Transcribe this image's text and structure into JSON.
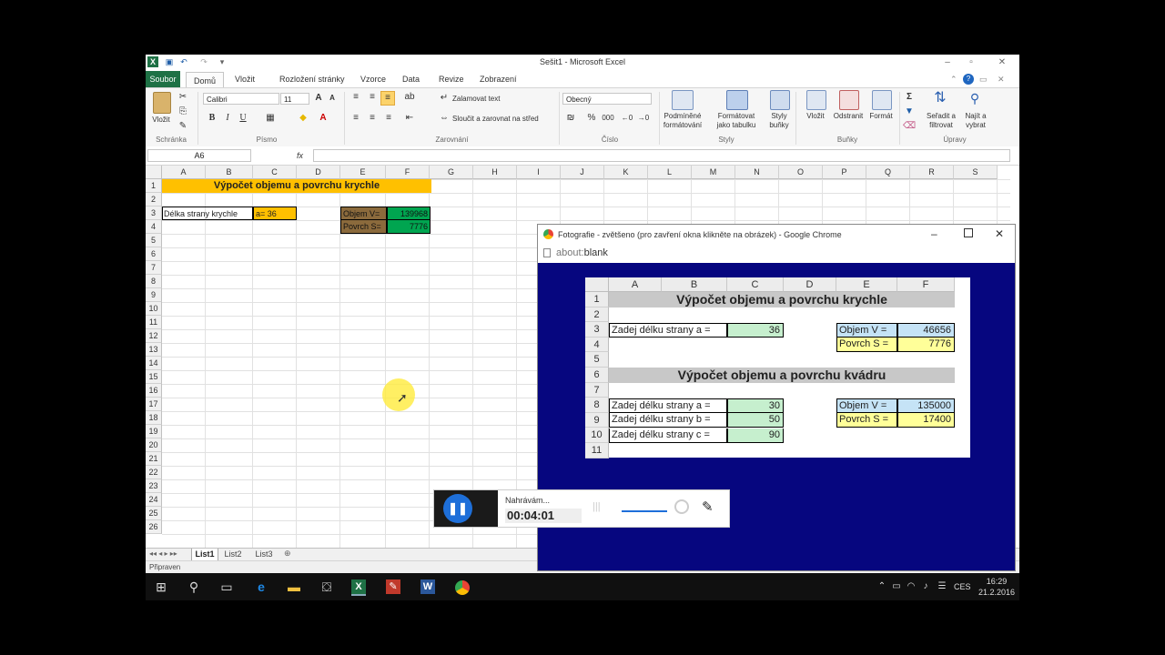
{
  "excel": {
    "window_title": "Sešit1 - Microsoft Excel",
    "tabs": [
      "Soubor",
      "Domů",
      "Vložit",
      "Rozložení stránky",
      "Vzorce",
      "Data",
      "Revize",
      "Zobrazení"
    ],
    "clipboard": {
      "paste": "Vložit",
      "group": "Schránka"
    },
    "font": {
      "name": "Calibri",
      "size": "11",
      "group": "Písmo"
    },
    "alignment": {
      "wrap": "Zalamovat text",
      "merge": "Sloučit a zarovnat na střed",
      "group": "Zarovnání"
    },
    "number": {
      "format": "Obecný",
      "group": "Číslo",
      "percent": "%",
      "thousands": "000"
    },
    "styles": {
      "cond1": "Podmíněné",
      "cond2": "formátování",
      "table1": "Formátovat",
      "table2": "jako tabulku",
      "cell1": "Styly",
      "cell2": "buňky",
      "group": "Styly"
    },
    "cells": {
      "insert": "Vložit",
      "delete": "Odstranit",
      "format": "Formát",
      "group": "Buňky"
    },
    "editing": {
      "sort1": "Seřadit a",
      "sort2": "filtrovat",
      "find1": "Najít a",
      "find2": "vybrat",
      "group": "Úpravy",
      "sigma": "Σ"
    },
    "name_box": "A6",
    "fx": "fx",
    "columns": [
      "A",
      "B",
      "C",
      "D",
      "E",
      "F",
      "G",
      "H",
      "I",
      "J",
      "K",
      "L",
      "M",
      "N",
      "O",
      "P",
      "Q",
      "R",
      "S"
    ],
    "rows": [
      "1",
      "2",
      "3",
      "4",
      "5",
      "6",
      "7",
      "8",
      "9",
      "10",
      "11",
      "12",
      "13",
      "14",
      "15",
      "16",
      "17",
      "18",
      "19",
      "20",
      "21",
      "22",
      "23",
      "24",
      "25",
      "26"
    ],
    "sheet": {
      "title": "Výpočet objemu a povrchu krychle",
      "side_label": "Délka strany krychle",
      "side_value": "a= 36",
      "volume_label": "Objem V=",
      "volume_value": "139968",
      "surface_label": "Povrch S=",
      "surface_value": "7776"
    },
    "sheet_tabs": [
      "List1",
      "List2",
      "List3"
    ],
    "status": "Připraven"
  },
  "chrome": {
    "title": "Fotografie - zvětšeno (pro zavření okna klikněte na obrázek) - Google Chrome",
    "url_prefix": "about:",
    "url_rest": "blank",
    "image": {
      "columns": [
        "A",
        "B",
        "C",
        "D",
        "E",
        "F"
      ],
      "rows": [
        "1",
        "2",
        "3",
        "4",
        "5",
        "6",
        "7",
        "8",
        "9",
        "10",
        "11"
      ],
      "cube_title": "Výpočet objemu a povrchu krychle",
      "cube_side_label": "Zadej délku strany a =",
      "cube_side_value": "36",
      "cube_volume_label": "Objem V =",
      "cube_volume_value": "46656",
      "cube_surface_label": "Povrch S =",
      "cube_surface_value": "7776",
      "box_title": "Výpočet objemu a povrchu kvádru",
      "box_a_label": "Zadej délku strany a =",
      "box_a_value": "30",
      "box_b_label": "Zadej délku strany b =",
      "box_b_value": "50",
      "box_c_label": "Zadej délku strany c =",
      "box_c_value": "90",
      "box_volume_label": "Objem V =",
      "box_volume_value": "135000",
      "box_surface_label": "Povrch S =",
      "box_surface_value": "17400"
    }
  },
  "recorder": {
    "status": "Nahrávám...",
    "time": "00:04:01"
  },
  "taskbar": {
    "time": "16:29",
    "date": "21.2.2016",
    "lang": "CES"
  },
  "colors": {
    "excel_green": "#1e7145",
    "orange": "#ffc000",
    "olive": "#8b6a3c",
    "green_cell": "#00a550",
    "navy": "#06067f"
  }
}
